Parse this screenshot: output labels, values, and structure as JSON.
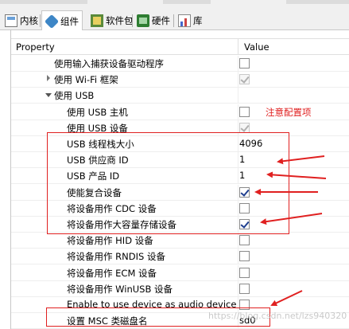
{
  "tabs": [
    {
      "label": "内核",
      "icon": "kernel-icon"
    },
    {
      "label": "组件",
      "icon": "component-icon"
    },
    {
      "label": "软件包",
      "icon": "package-icon"
    },
    {
      "label": "硬件",
      "icon": "hardware-icon"
    },
    {
      "label": "库",
      "icon": "library-icon"
    }
  ],
  "table": {
    "header_property": "Property",
    "header_value": "Value",
    "rows": [
      {
        "label": "使用输入捕获设备驱动程序",
        "type": "checkbox",
        "checked": false
      },
      {
        "label": "使用 Wi-Fi 框架",
        "type": "checkbox",
        "checked": true,
        "disabled": true,
        "expander": "closed"
      },
      {
        "label": "使用 USB",
        "type": "none",
        "expander": "open"
      },
      {
        "label": "使用 USB 主机",
        "type": "checkbox",
        "checked": false
      },
      {
        "label": "使用 USB 设备",
        "type": "checkbox",
        "checked": true,
        "disabled": true
      },
      {
        "label": "USB 线程栈大小",
        "type": "text",
        "value": "4096"
      },
      {
        "label": "USB 供应商 ID",
        "type": "text",
        "value": "1"
      },
      {
        "label": "USB 产品 ID",
        "type": "text",
        "value": "1"
      },
      {
        "label": "使能复合设备",
        "type": "checkbox",
        "checked": true
      },
      {
        "label": "将设备用作 CDC 设备",
        "type": "checkbox",
        "checked": false
      },
      {
        "label": "将设备用作大容量存储设备",
        "type": "checkbox",
        "checked": true
      },
      {
        "label": "将设备用作 HID 设备",
        "type": "checkbox",
        "checked": false
      },
      {
        "label": "将设备用作 RNDIS 设备",
        "type": "checkbox",
        "checked": false
      },
      {
        "label": "将设备用作 ECM 设备",
        "type": "checkbox",
        "checked": false
      },
      {
        "label": "将设备用作 WinUSB 设备",
        "type": "checkbox",
        "checked": false
      },
      {
        "label": "Enable to use device as audio device",
        "type": "checkbox",
        "checked": false
      },
      {
        "label": "设置 MSC 类磁盘名",
        "type": "text",
        "value": "sd0"
      }
    ]
  },
  "annotation_note": "注意配置项",
  "watermark": "https://blog.csdn.net/lzs940320",
  "colors": {
    "annotation": "#e02020",
    "tab_bg": "#f0f0f0",
    "border": "#c8c8c8"
  }
}
